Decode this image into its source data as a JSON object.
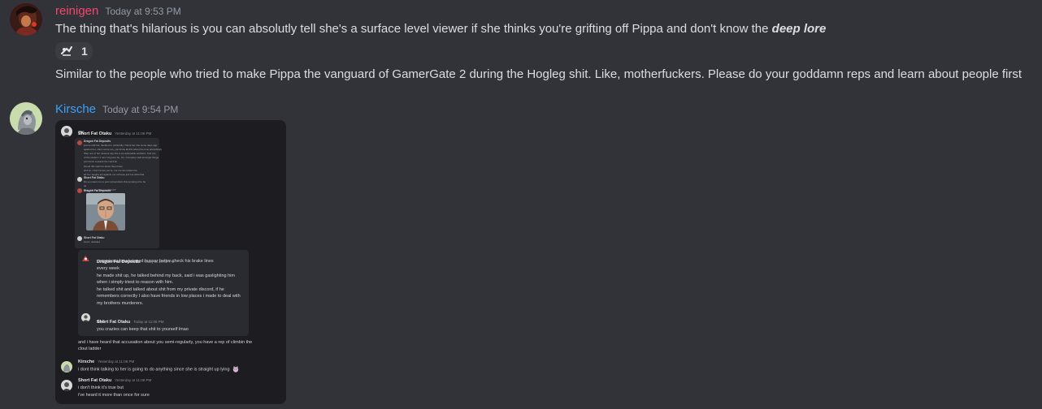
{
  "messages": [
    {
      "username": "reinigen",
      "timestamp": "Today at 9:53 PM",
      "lines": [
        {
          "before_emphasis": "The thing that's hilarious is you can absolutly tell she's a surface level viewer if she thinks you're grifting off Pippa and don't know the ",
          "emphasis": "deep lore"
        },
        {
          "text": "Similar to the people who tried to make Pippa the vanguard of GamerGate 2 during the Hogleg shit. Like, motherfuckers. Please do your goddamn reps and learn about people first"
        }
      ],
      "reaction": {
        "emoji": "custom-emote-icon",
        "count": "1"
      }
    },
    {
      "username": "Kirsche",
      "timestamp": "Today at 9:54 PM",
      "attachment": {
        "top_message": {
          "name": "Short Fat Otaku",
          "time": "Yesterday at 11:06 PM",
          "text": "OK"
        },
        "inner_block1_lines": [
          "Dragon Fat Deposits",
          "just so told her, decided to unfriendly / block her she some days ago",
          "against her, she's some ran, you know all this about the time accordingly",
          "Was one of her viewers say she is an actionable accident. Just pro",
          "of the random 1 min I'd Ignore be, too, Company stuff amongst things",
          "you let be a peace the mind be",
          "shoud this wait but about them lines",
          "and so, I don't know you're, nor me are tooken be",
          "ah he / laughs act against our of these just but what that"
        ],
        "inner_block1_reply_name": "Short Fat Otaku",
        "inner_block1_reply_lines": [
          "Do you want me to post screenshots this jumping of to be",
          "ok",
          "also, and my bitta you didn't!?"
        ],
        "inner_block1_meme_name": "Dragon Fat Deposits",
        "inner_block1_footer_name": "Short Fat Otaku",
        "inner_block1_footer_text": "Got it, retarded",
        "block2": {
          "name": "Dragon Fat Deposits",
          "time": "Today at 10:02 PM",
          "lines": [
            "commissar luna/winged hussar better check his brake lines",
            "every week",
            "he made shit up, he talked behind my back, said i was gaslighting him",
            "when i simply triest to reason with him.",
            "he talked shit and talked about shit from my private discord, if he",
            "remembers correctly I also have friends in low places i made to deal with",
            "my brothers murderers."
          ],
          "reply_name": "Short Fat Otaku",
          "reply_time": "Today at 11:05 PM",
          "reply_lines": [
            "well",
            "you crazies can keep that shit to yourself lmao"
          ]
        },
        "bottom_lines": [
          "and i have heard that accusation about you semi-regularly, you have a rep of climbin the",
          "clout ladder"
        ],
        "kirsche_msg": {
          "name": "Kirsche",
          "time": "Yesterday at 11:08 PM",
          "text": "i dont think talking to her is going to do anything since she is straight up lying"
        },
        "otaku_msg": {
          "name": "Short Fat Otaku",
          "time": "Yesterday at 11:09 PM",
          "lines": [
            "i don't think it's true but",
            "i've heard it more than once for sure"
          ]
        }
      }
    }
  ],
  "colors": {
    "background": "#323339",
    "reinigen_name": "#f0476d",
    "kirsche_name": "#3ba1f7",
    "timestamp": "#949ba4",
    "text": "#dbdee1",
    "reaction_bg": "#3b3c42"
  }
}
